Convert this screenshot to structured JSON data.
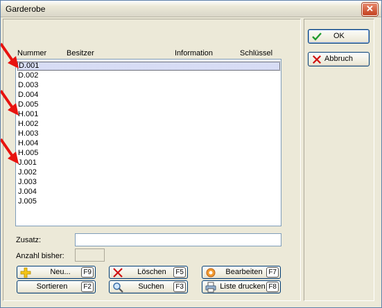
{
  "window": {
    "title": "Garderobe",
    "close_glyph": "✕"
  },
  "list": {
    "columns": [
      "Nummer",
      "Besitzer",
      "Information",
      "Schlüssel"
    ],
    "rows": [
      "D.001",
      "D.002",
      "D.003",
      "D.004",
      "D.005",
      "H.001",
      "H.002",
      "H.003",
      "H.004",
      "H.005",
      "J.001",
      "J.002",
      "J.003",
      "J.004",
      "J.005"
    ],
    "selected_index": 0
  },
  "form": {
    "zusatz_label": "Zusatz:",
    "zusatz_value": "",
    "anzahl_label": "Anzahl bisher:",
    "anzahl_value": ""
  },
  "buttons": {
    "neu": {
      "label": "Neu...",
      "key": "F9"
    },
    "loeschen": {
      "label": "Löschen",
      "key": "F5"
    },
    "bearbeiten": {
      "label": "Bearbeiten",
      "key": "F7"
    },
    "sortieren": {
      "label": "Sortieren",
      "key": "F2"
    },
    "suchen": {
      "label": "Suchen",
      "key": "F3"
    },
    "liste_drucken": {
      "label": "Liste drucken",
      "key": "F8"
    },
    "ok": {
      "label": "OK"
    },
    "abbruch": {
      "label": "Abbruch"
    }
  },
  "colors": {
    "accent": "#003c74",
    "selection": "#d7dcf5",
    "annotation_arrow": "#e8130f"
  }
}
